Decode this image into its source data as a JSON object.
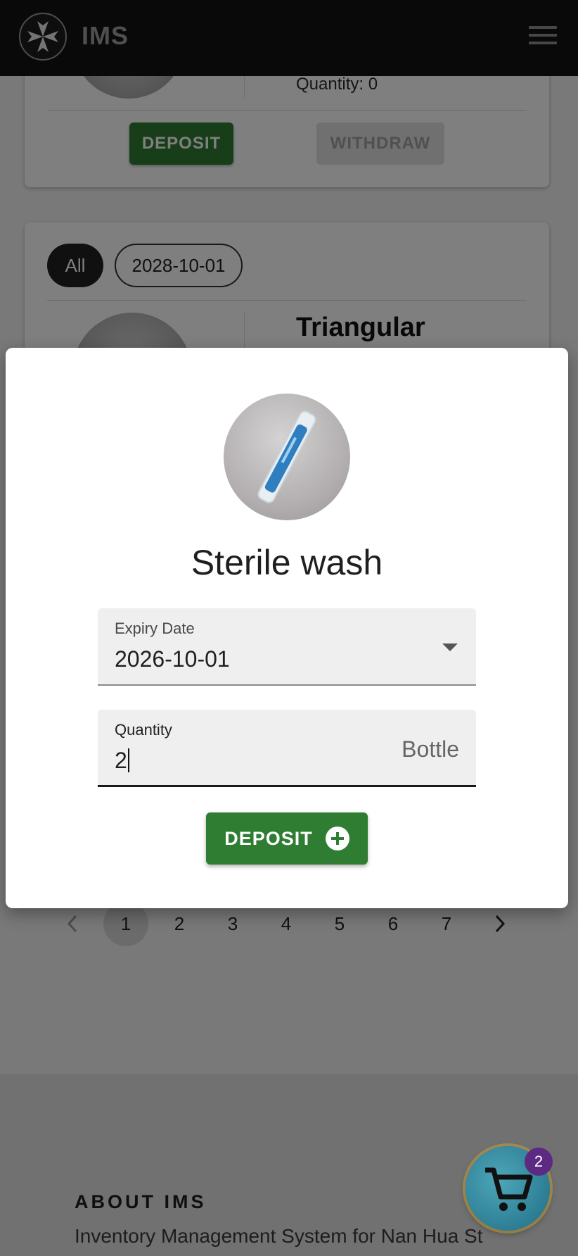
{
  "app": {
    "title": "IMS"
  },
  "inventory": {
    "top_card": {
      "quantity_label": "Quantity: 0",
      "deposit_label": "DEPOSIT",
      "withdraw_label": "WITHDRAW"
    },
    "second_card": {
      "filters": [
        "All",
        "2028-10-01"
      ],
      "selected_filter": "All",
      "item_name": "Triangular"
    }
  },
  "pagination": {
    "pages": [
      "1",
      "2",
      "3",
      "4",
      "5",
      "6",
      "7"
    ],
    "current_page": "1",
    "prev_icon": "chevron-left-icon",
    "next_icon": "chevron-right-icon"
  },
  "footer": {
    "about_title": "ABOUT IMS",
    "about_text": "Inventory Management System for Nan Hua St"
  },
  "modal": {
    "product_name": "Sterile wash",
    "expiry_label": "Expiry Date",
    "expiry_value": "2026-10-01",
    "quantity_label": "Quantity",
    "quantity_value": "2",
    "quantity_unit": "Bottle",
    "deposit_label": "DEPOSIT"
  },
  "cart": {
    "badge_count": "2",
    "icon": "cart-icon"
  },
  "colors": {
    "appbar": "#121212",
    "primary_green": "#2e7d32",
    "fab": "#2b88a0",
    "badge": "#5d2a83"
  }
}
